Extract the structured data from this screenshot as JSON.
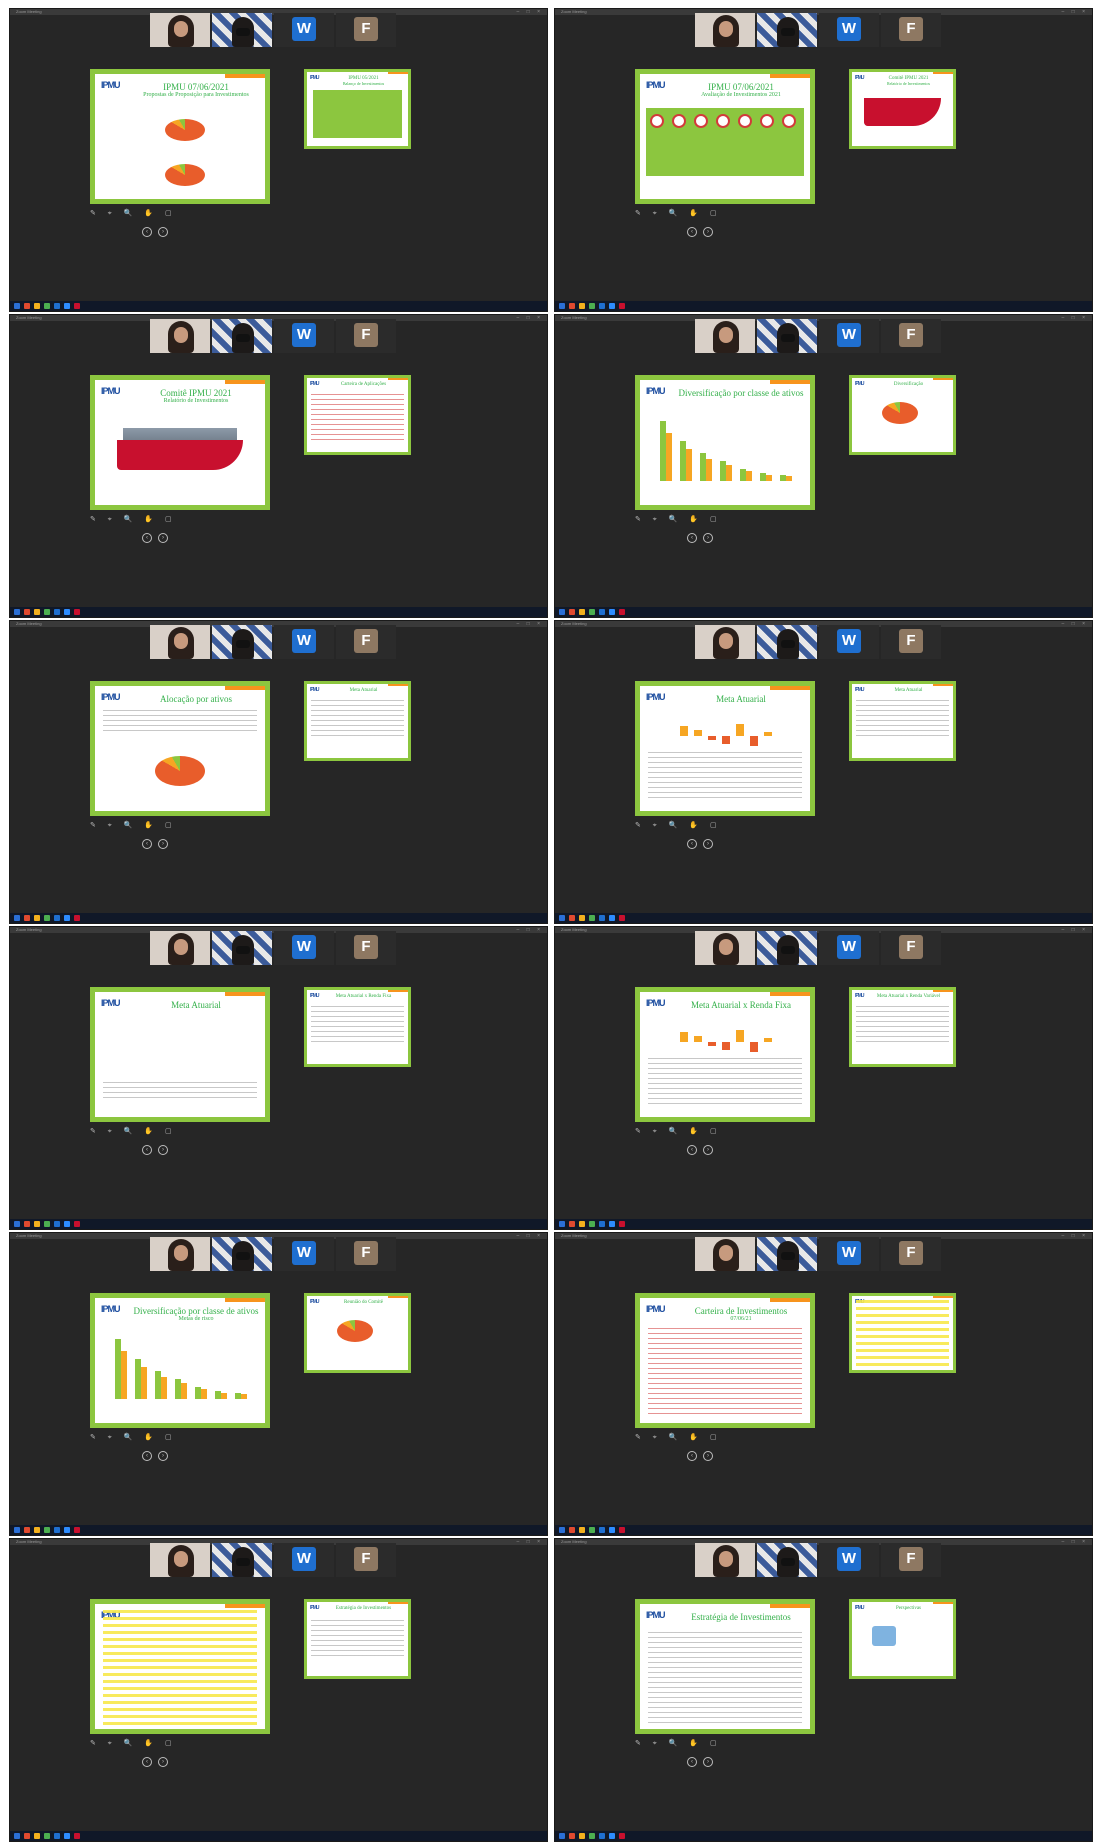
{
  "screens": [
    {
      "main_title": "IPMU 07/06/2021",
      "main_subtitle": "Propostas de Proposição para Investimentos",
      "side_title": "IPMU 05/2021",
      "side_subtitle": "Balanço de Investimentos"
    },
    {
      "main_title": "IPMU 07/06/2021",
      "main_subtitle": "Avaliação de Investimentos 2021",
      "side_title": "Comitê IPMU 2021",
      "side_subtitle": "Relatório de Investimentos"
    },
    {
      "main_title": "Comitê IPMU 2021",
      "main_subtitle": "Relatório de Investimentos",
      "side_title": "Carteira de Aplicações",
      "side_subtitle": ""
    },
    {
      "main_title": "Diversificação por classe de ativos",
      "main_subtitle": "",
      "side_title": "Diversificação",
      "side_subtitle": ""
    },
    {
      "main_title": "Alocação por ativos",
      "main_subtitle": "",
      "side_title": "Meta Atuarial",
      "side_subtitle": ""
    },
    {
      "main_title": "Meta Atuarial",
      "main_subtitle": "",
      "side_title": "Meta Atuarial",
      "side_subtitle": ""
    },
    {
      "main_title": "Meta Atuarial",
      "main_subtitle": "",
      "side_title": "Meta Atuarial x Renda Fixa",
      "side_subtitle": ""
    },
    {
      "main_title": "Meta Atuarial x Renda Fixa",
      "main_subtitle": "",
      "side_title": "Meta Atuarial x Renda Variável",
      "side_subtitle": ""
    },
    {
      "main_title": "Diversificação por classe de ativos",
      "main_subtitle": "Metas de risco",
      "side_title": "Reunião do Comitê",
      "side_subtitle": ""
    },
    {
      "main_title": "Carteira de Investimentos",
      "main_subtitle": "07/06/21",
      "side_title": "",
      "side_subtitle": ""
    },
    {
      "main_title": "",
      "main_subtitle": "",
      "side_title": "Estratégia de Investimentos",
      "side_subtitle": ""
    },
    {
      "main_title": "Estratégia de Investimentos",
      "main_subtitle": "",
      "side_title": "Perspectivas",
      "side_subtitle": ""
    }
  ],
  "common": {
    "window_title": "Zoom Meeting",
    "window_controls": "– □ ×",
    "logo_text": "IPMU",
    "avatar_w": "W",
    "avatar_f": "F",
    "pager_prev": "‹",
    "pager_next": "›",
    "toolbar_icons": "✎ ⌖ 🔍 ✋ ▢"
  },
  "colors": {
    "slide_border": "#8cc63f",
    "title_green": "#34b04a",
    "accent_orange": "#f7941d",
    "accent_red": "#c8102e",
    "taskbar": "#101828"
  }
}
